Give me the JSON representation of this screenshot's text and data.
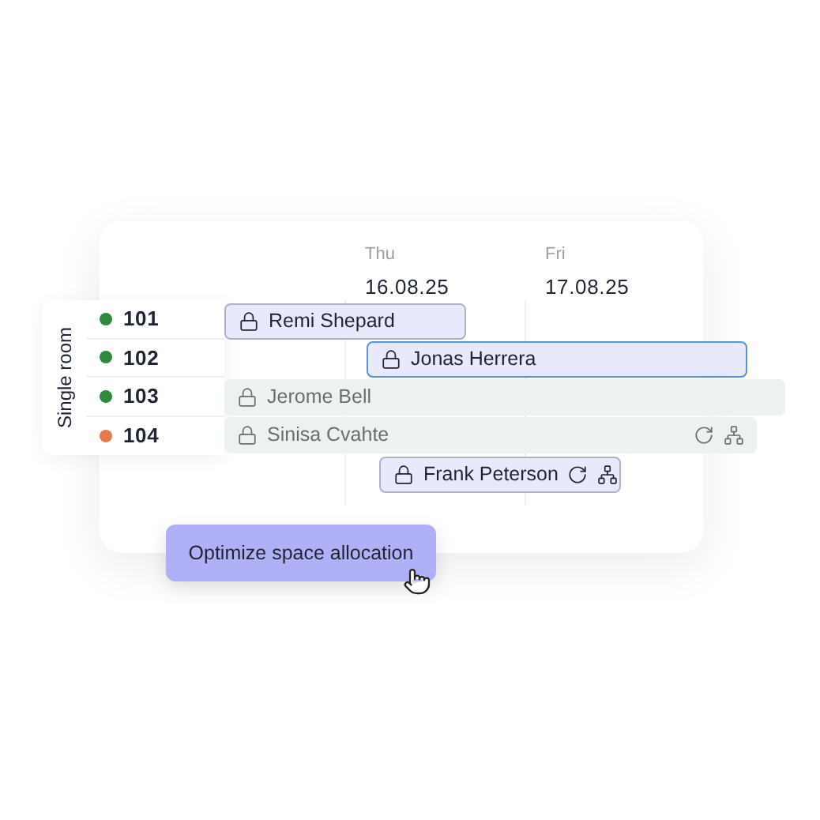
{
  "days": [
    {
      "weekday": "Thu",
      "date": "16.08.25"
    },
    {
      "weekday": "Fri",
      "date": "17.08.25"
    }
  ],
  "room_group": "Single room",
  "rooms": [
    {
      "number": "101",
      "color": "#2e8b3a"
    },
    {
      "number": "102",
      "color": "#2e8b3a"
    },
    {
      "number": "103",
      "color": "#2e8b3a"
    },
    {
      "number": "104",
      "color": "#e8794a"
    }
  ],
  "bookings": [
    {
      "guest": "Remi Shepard",
      "kind": "assigned",
      "selected": false,
      "recurring": false
    },
    {
      "guest": "Jonas Herrera",
      "kind": "assigned",
      "selected": true,
      "recurring": false
    },
    {
      "guest": "Jerome Bell",
      "kind": "unassigned",
      "selected": false,
      "recurring": false
    },
    {
      "guest": "Sinisa Cvahte",
      "kind": "unassigned",
      "selected": false,
      "recurring": true
    },
    {
      "guest": "Frank Peterson",
      "kind": "assigned",
      "selected": false,
      "recurring": true
    }
  ],
  "action_button": {
    "label": "Optimize space allocation"
  }
}
